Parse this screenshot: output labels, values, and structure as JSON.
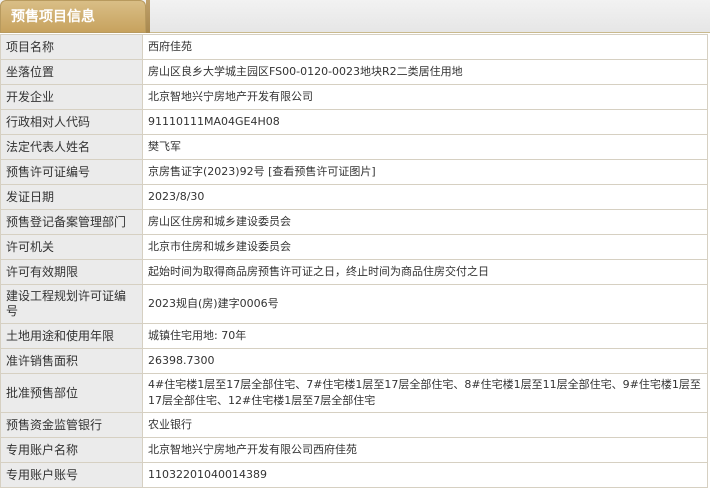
{
  "tab": {
    "title": "预售项目信息"
  },
  "rows": [
    {
      "label": "项目名称",
      "value": "西府佳苑"
    },
    {
      "label": "坐落位置",
      "value": "房山区良乡大学城主园区FS00-0120-0023地块R2二类居住用地"
    },
    {
      "label": "开发企业",
      "value": "北京智地兴宁房地产开发有限公司"
    },
    {
      "label": "行政相对人代码",
      "value": "91110111MA04GE4H08"
    },
    {
      "label": "法定代表人姓名",
      "value": "樊飞军"
    },
    {
      "label": "预售许可证编号",
      "value": "京房售证字(2023)92号",
      "link": "[查看预售许可证图片]"
    },
    {
      "label": "发证日期",
      "value": "2023/8/30"
    },
    {
      "label": "预售登记备案管理部门",
      "value": "房山区住房和城乡建设委员会"
    },
    {
      "label": "许可机关",
      "value": "北京市住房和城乡建设委员会"
    },
    {
      "label": "许可有效期限",
      "value": "起始时间为取得商品房预售许可证之日，终止时间为商品住房交付之日"
    },
    {
      "label": "建设工程规划许可证编号",
      "value": "2023规自(房)建字0006号"
    },
    {
      "label": "土地用途和使用年限",
      "value": "城镇住宅用地: 70年"
    },
    {
      "label": "准许销售面积",
      "value": "26398.7300"
    },
    {
      "label": "批准预售部位",
      "value": "4#住宅楼1层至17层全部住宅、7#住宅楼1层至17层全部住宅、8#住宅楼1层至11层全部住宅、9#住宅楼1层至17层全部住宅、12#住宅楼1层至7层全部住宅"
    },
    {
      "label": "预售资金监管银行",
      "value": "农业银行"
    },
    {
      "label": "专用账户名称",
      "value": "北京智地兴宁房地产开发有限公司西府佳苑"
    },
    {
      "label": "专用账户账号",
      "value": "11032201040014389"
    }
  ]
}
